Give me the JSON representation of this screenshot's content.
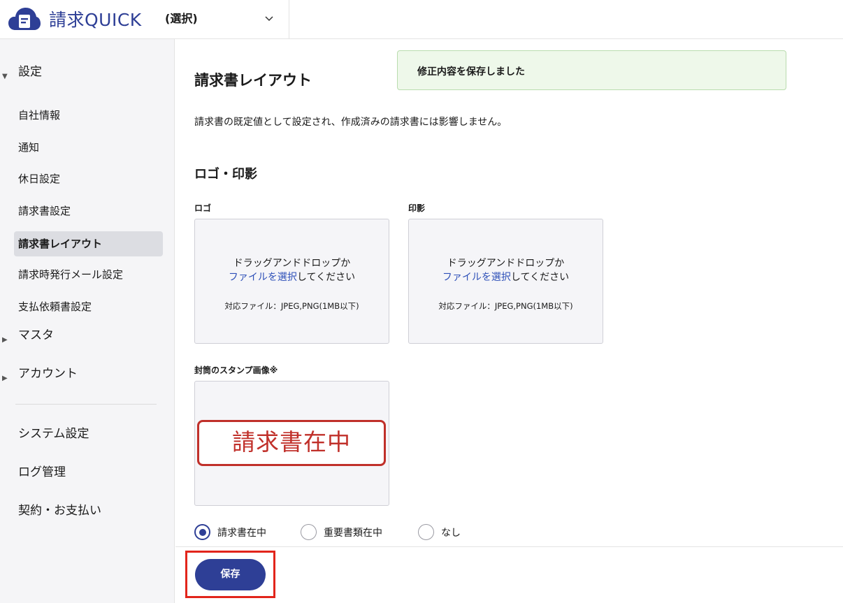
{
  "header": {
    "app_name": "請求QUICK",
    "tenant_label": "(選択)"
  },
  "sidebar": {
    "group_settings": "設定",
    "items": [
      {
        "label": "自社情報"
      },
      {
        "label": "通知"
      },
      {
        "label": "休日設定"
      },
      {
        "label": "請求書設定"
      },
      {
        "label": "請求書レイアウト",
        "active": true
      },
      {
        "label": "請求時発行メール設定"
      },
      {
        "label": "支払依頼書設定"
      }
    ],
    "group_master": "マスタ",
    "group_account": "アカウント",
    "system_items": [
      "システム設定",
      "ログ管理",
      "契約・お支払い"
    ]
  },
  "main": {
    "title": "請求書レイアウト",
    "toast": "修正内容を保存しました",
    "description": "請求書の既定値として設定され、作成済みの請求書には影響しません。",
    "section_title": "ロゴ・印影",
    "logo": {
      "label": "ロゴ",
      "line1": "ドラッグアンドドロップか",
      "link": "ファイルを選択",
      "line2_suffix": "してください",
      "formats": "対応ファイル：JPEG,PNG(1MB以下)"
    },
    "seal": {
      "label": "印影",
      "line1": "ドラッグアンドドロップか",
      "link": "ファイルを選択",
      "line2_suffix": "してください",
      "formats": "対応ファイル：JPEG,PNG(1MB以下)"
    },
    "envelope": {
      "label": "封筒のスタンプ画像※",
      "stamp_text": "請求書在中"
    },
    "stamp_options": [
      {
        "label": "請求書在中",
        "selected": true
      },
      {
        "label": "重要書類在中",
        "selected": false
      },
      {
        "label": "なし",
        "selected": false
      }
    ],
    "save_label": "保存"
  },
  "colors": {
    "brand": "#2e3f96",
    "highlight": "#e2251b",
    "stamp_red": "#c0302a",
    "toast_bg": "#eef8ea"
  }
}
